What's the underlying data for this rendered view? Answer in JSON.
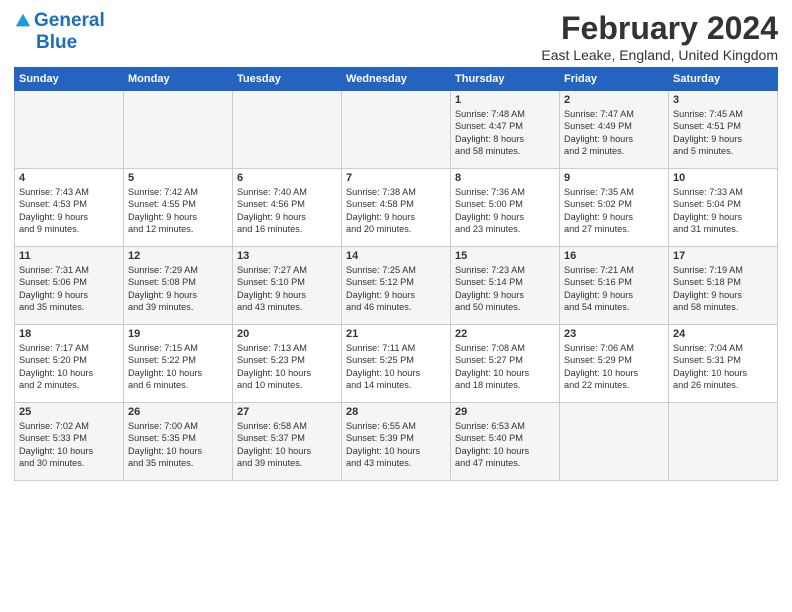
{
  "logo": {
    "line1": "General",
    "line2": "Blue"
  },
  "title": "February 2024",
  "subtitle": "East Leake, England, United Kingdom",
  "days_of_week": [
    "Sunday",
    "Monday",
    "Tuesday",
    "Wednesday",
    "Thursday",
    "Friday",
    "Saturday"
  ],
  "weeks": [
    [
      {
        "day": "",
        "info": ""
      },
      {
        "day": "",
        "info": ""
      },
      {
        "day": "",
        "info": ""
      },
      {
        "day": "",
        "info": ""
      },
      {
        "day": "1",
        "info": "Sunrise: 7:48 AM\nSunset: 4:47 PM\nDaylight: 8 hours\nand 58 minutes."
      },
      {
        "day": "2",
        "info": "Sunrise: 7:47 AM\nSunset: 4:49 PM\nDaylight: 9 hours\nand 2 minutes."
      },
      {
        "day": "3",
        "info": "Sunrise: 7:45 AM\nSunset: 4:51 PM\nDaylight: 9 hours\nand 5 minutes."
      }
    ],
    [
      {
        "day": "4",
        "info": "Sunrise: 7:43 AM\nSunset: 4:53 PM\nDaylight: 9 hours\nand 9 minutes."
      },
      {
        "day": "5",
        "info": "Sunrise: 7:42 AM\nSunset: 4:55 PM\nDaylight: 9 hours\nand 12 minutes."
      },
      {
        "day": "6",
        "info": "Sunrise: 7:40 AM\nSunset: 4:56 PM\nDaylight: 9 hours\nand 16 minutes."
      },
      {
        "day": "7",
        "info": "Sunrise: 7:38 AM\nSunset: 4:58 PM\nDaylight: 9 hours\nand 20 minutes."
      },
      {
        "day": "8",
        "info": "Sunrise: 7:36 AM\nSunset: 5:00 PM\nDaylight: 9 hours\nand 23 minutes."
      },
      {
        "day": "9",
        "info": "Sunrise: 7:35 AM\nSunset: 5:02 PM\nDaylight: 9 hours\nand 27 minutes."
      },
      {
        "day": "10",
        "info": "Sunrise: 7:33 AM\nSunset: 5:04 PM\nDaylight: 9 hours\nand 31 minutes."
      }
    ],
    [
      {
        "day": "11",
        "info": "Sunrise: 7:31 AM\nSunset: 5:06 PM\nDaylight: 9 hours\nand 35 minutes."
      },
      {
        "day": "12",
        "info": "Sunrise: 7:29 AM\nSunset: 5:08 PM\nDaylight: 9 hours\nand 39 minutes."
      },
      {
        "day": "13",
        "info": "Sunrise: 7:27 AM\nSunset: 5:10 PM\nDaylight: 9 hours\nand 43 minutes."
      },
      {
        "day": "14",
        "info": "Sunrise: 7:25 AM\nSunset: 5:12 PM\nDaylight: 9 hours\nand 46 minutes."
      },
      {
        "day": "15",
        "info": "Sunrise: 7:23 AM\nSunset: 5:14 PM\nDaylight: 9 hours\nand 50 minutes."
      },
      {
        "day": "16",
        "info": "Sunrise: 7:21 AM\nSunset: 5:16 PM\nDaylight: 9 hours\nand 54 minutes."
      },
      {
        "day": "17",
        "info": "Sunrise: 7:19 AM\nSunset: 5:18 PM\nDaylight: 9 hours\nand 58 minutes."
      }
    ],
    [
      {
        "day": "18",
        "info": "Sunrise: 7:17 AM\nSunset: 5:20 PM\nDaylight: 10 hours\nand 2 minutes."
      },
      {
        "day": "19",
        "info": "Sunrise: 7:15 AM\nSunset: 5:22 PM\nDaylight: 10 hours\nand 6 minutes."
      },
      {
        "day": "20",
        "info": "Sunrise: 7:13 AM\nSunset: 5:23 PM\nDaylight: 10 hours\nand 10 minutes."
      },
      {
        "day": "21",
        "info": "Sunrise: 7:11 AM\nSunset: 5:25 PM\nDaylight: 10 hours\nand 14 minutes."
      },
      {
        "day": "22",
        "info": "Sunrise: 7:08 AM\nSunset: 5:27 PM\nDaylight: 10 hours\nand 18 minutes."
      },
      {
        "day": "23",
        "info": "Sunrise: 7:06 AM\nSunset: 5:29 PM\nDaylight: 10 hours\nand 22 minutes."
      },
      {
        "day": "24",
        "info": "Sunrise: 7:04 AM\nSunset: 5:31 PM\nDaylight: 10 hours\nand 26 minutes."
      }
    ],
    [
      {
        "day": "25",
        "info": "Sunrise: 7:02 AM\nSunset: 5:33 PM\nDaylight: 10 hours\nand 30 minutes."
      },
      {
        "day": "26",
        "info": "Sunrise: 7:00 AM\nSunset: 5:35 PM\nDaylight: 10 hours\nand 35 minutes."
      },
      {
        "day": "27",
        "info": "Sunrise: 6:58 AM\nSunset: 5:37 PM\nDaylight: 10 hours\nand 39 minutes."
      },
      {
        "day": "28",
        "info": "Sunrise: 6:55 AM\nSunset: 5:39 PM\nDaylight: 10 hours\nand 43 minutes."
      },
      {
        "day": "29",
        "info": "Sunrise: 6:53 AM\nSunset: 5:40 PM\nDaylight: 10 hours\nand 47 minutes."
      },
      {
        "day": "",
        "info": ""
      },
      {
        "day": "",
        "info": ""
      }
    ]
  ]
}
